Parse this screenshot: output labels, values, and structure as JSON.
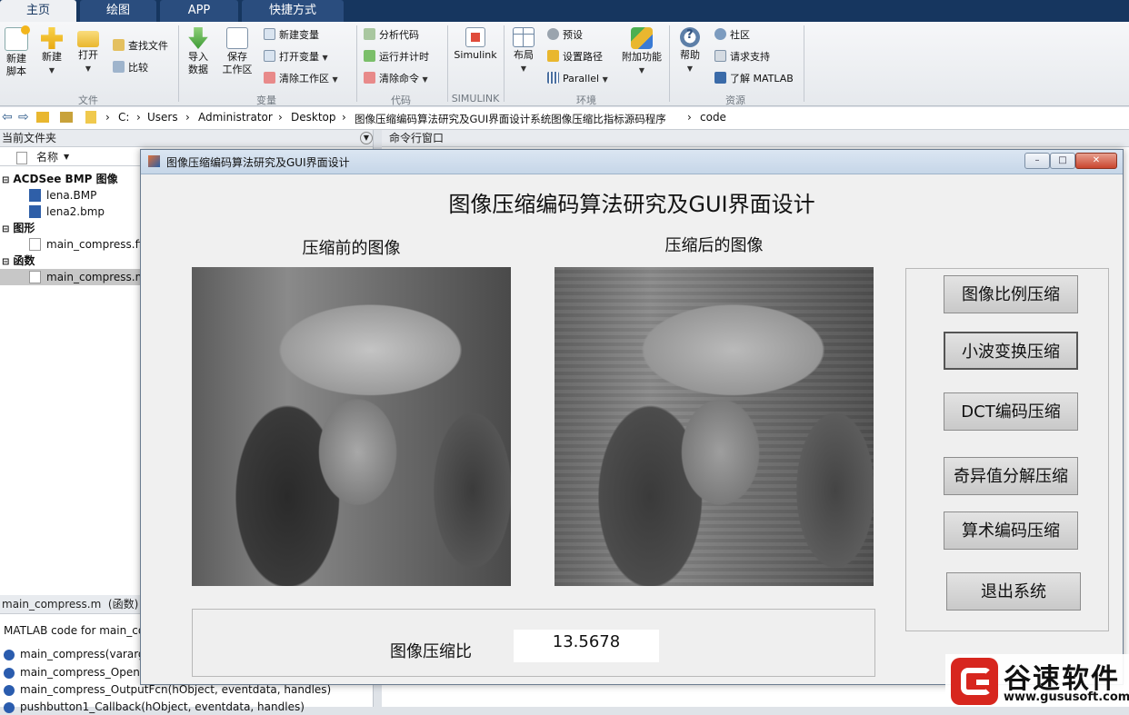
{
  "tabs": [
    "主页",
    "绘图",
    "APP",
    "快捷方式"
  ],
  "ribbon": {
    "file": {
      "new_script": "新建\n脚本",
      "new": "新建",
      "open": "打开",
      "find_files": "查找文件",
      "compare": "比较",
      "group": "文件"
    },
    "variable": {
      "import": "导入\n数据",
      "save_ws": "保存\n工作区",
      "new_var": "新建变量",
      "open_var": "打开变量",
      "clear_ws": "清除工作区",
      "group": "变量"
    },
    "code": {
      "analyze": "分析代码",
      "run_time": "运行并计时",
      "clear_cmds": "清除命令",
      "group": "代码"
    },
    "simulink": {
      "label": "Simulink",
      "group": "SIMULINK"
    },
    "env": {
      "layout": "布局",
      "prefs": "预设",
      "set_path": "设置路径",
      "parallel": "Parallel",
      "addons": "附加功能",
      "group": "环境"
    },
    "resources": {
      "help": "帮助",
      "community": "社区",
      "support": "请求支持",
      "learn": "了解 MATLAB",
      "group": "资源"
    }
  },
  "path": [
    "C:",
    "Users",
    "Administrator",
    "Desktop",
    "图像压缩编码算法研究及GUI界面设计系统图像压缩比指标源码程序",
    "code"
  ],
  "left_panel": {
    "title": "当前文件夹",
    "col_name": "名称",
    "groups": [
      {
        "label": "ACDSee BMP 图像",
        "files": [
          "lena.BMP",
          "lena2.bmp"
        ]
      },
      {
        "label": "图形",
        "files": [
          "main_compress.fig"
        ]
      },
      {
        "label": "函数",
        "files": [
          "main_compress.m"
        ]
      }
    ],
    "details_title": "main_compress.m  (函数)",
    "details_desc": "MATLAB code for main_compress.fig",
    "functions": [
      "main_compress(varargin)",
      "main_compress_OpeningFcn(hObject, eventdata, handles, varargin)",
      "main_compress_OutputFcn(hObject, eventdata, handles)",
      "pushbutton1_Callback(hObject, eventdata, handles)"
    ]
  },
  "command_window": {
    "title": "命令行窗口"
  },
  "dialog": {
    "window_title": "图像压缩编码算法研究及GUI界面设计",
    "heading": "图像压缩编码算法研究及GUI界面设计",
    "before_label": "压缩前的图像",
    "after_label": "压缩后的图像",
    "buttons": [
      "图像比例压缩",
      "小波变换压缩",
      "DCT编码压缩",
      "奇异值分解压缩",
      "算术编码压缩",
      "退出系统"
    ],
    "ratio_label": "图像压缩比",
    "ratio_value": "13.5678"
  },
  "watermark": {
    "brand": "谷速软件",
    "url": "www.gususoft.com"
  },
  "colors": {
    "ribbon_tab_bar": "#16365f",
    "panel_bg": "#f0f0f0",
    "logo_red": "#d7261e"
  }
}
